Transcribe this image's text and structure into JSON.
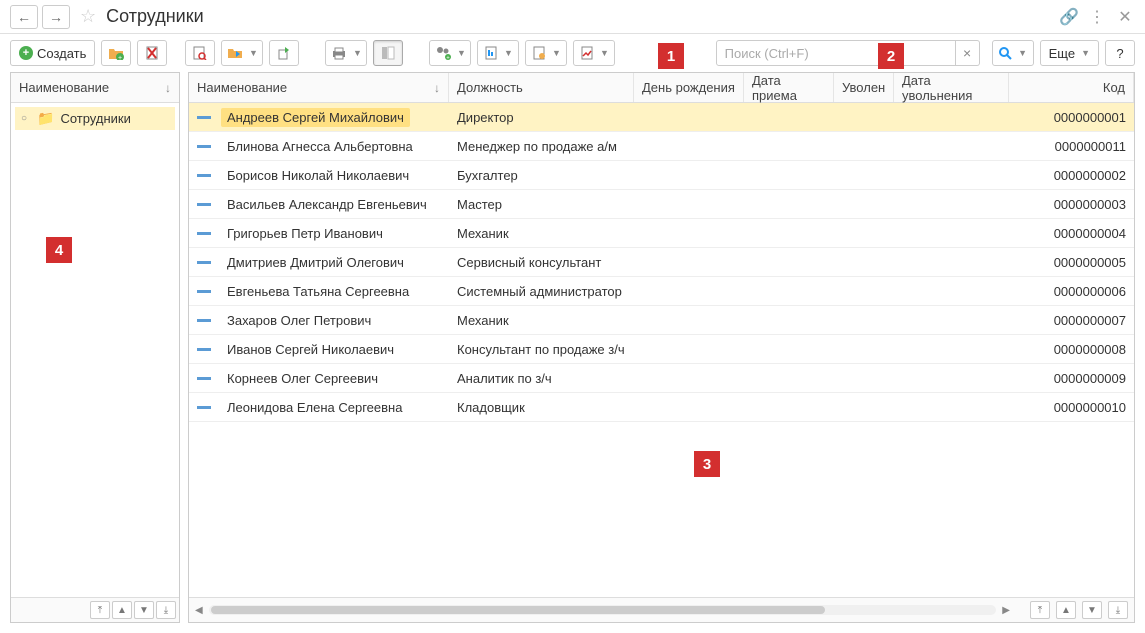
{
  "title": "Сотрудники",
  "toolbar": {
    "create_label": "Создать",
    "more_label": "Еще",
    "help_label": "?"
  },
  "search": {
    "placeholder": "Поиск (Ctrl+F)"
  },
  "left": {
    "header": "Наименование",
    "root": "Сотрудники"
  },
  "grid": {
    "columns": {
      "name": "Наименование",
      "position": "Должность",
      "birthday": "День рождения",
      "hire_date": "Дата приема",
      "fired": "Уволен",
      "fire_date": "Дата увольнения",
      "code": "Код"
    },
    "rows": [
      {
        "name": "Андреев Сергей Михайлович",
        "position": "Директор",
        "code": "0000000001"
      },
      {
        "name": "Блинова Агнесса Альбертовна",
        "position": "Менеджер по продаже а/м",
        "code": "0000000011"
      },
      {
        "name": "Борисов Николай Николаевич",
        "position": "Бухгалтер",
        "code": "0000000002"
      },
      {
        "name": "Васильев Александр Евгеньевич",
        "position": "Мастер",
        "code": "0000000003"
      },
      {
        "name": "Григорьев Петр Иванович",
        "position": "Механик",
        "code": "0000000004"
      },
      {
        "name": "Дмитриев Дмитрий Олегович",
        "position": "Сервисный консультант",
        "code": "0000000005"
      },
      {
        "name": "Евгеньева Татьяна Сергеевна",
        "position": "Системный администратор",
        "code": "0000000006"
      },
      {
        "name": "Захаров Олег Петрович",
        "position": "Механик",
        "code": "0000000007"
      },
      {
        "name": "Иванов Сергей Николаевич",
        "position": "Консультант по продаже з/ч",
        "code": "0000000008"
      },
      {
        "name": "Корнеев Олег Сергеевич",
        "position": "Аналитик по з/ч",
        "code": "0000000009"
      },
      {
        "name": "Леонидова Елена Сергеевна",
        "position": "Кладовщик",
        "code": "0000000010"
      }
    ]
  },
  "callouts": {
    "c1": "1",
    "c2": "2",
    "c3": "3",
    "c4": "4"
  }
}
